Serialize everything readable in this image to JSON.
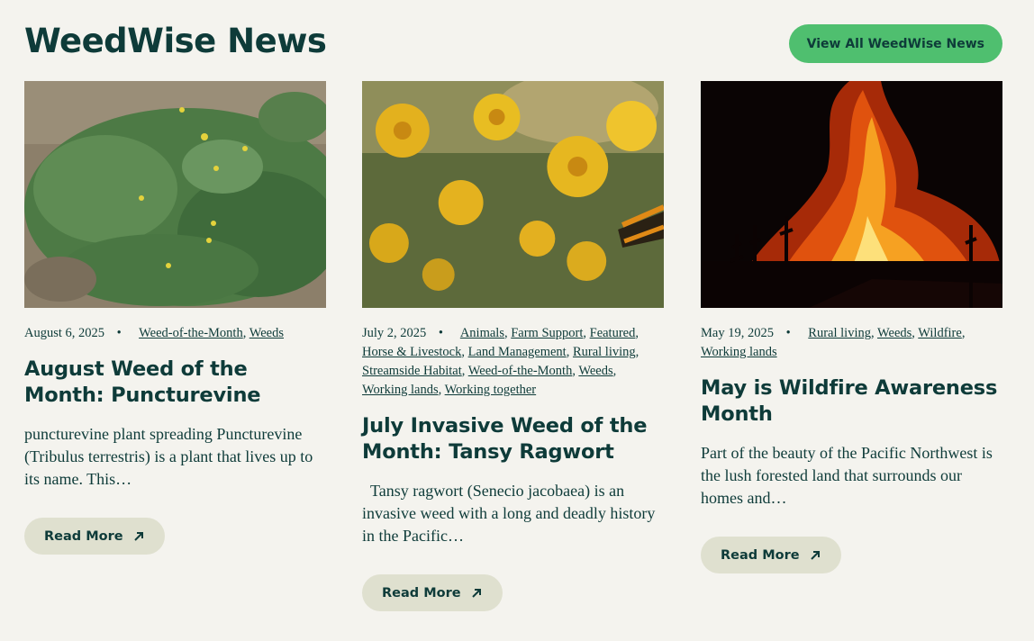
{
  "page": {
    "title": "WeedWise News",
    "view_all_label": "View All WeedWise News"
  },
  "cards": [
    {
      "date": "August 6, 2025",
      "categories": [
        "Weed-of-the-Month",
        "Weeds"
      ],
      "title": "August Weed of the Month: Puncturevine",
      "excerpt": "puncturevine plant spreading Puncturevine (Tribulus terrestris) is a plant that lives up to its name.  This…",
      "read_more": "Read More",
      "image": "puncturevine-plant-photo"
    },
    {
      "date": "July 2, 2025",
      "categories": [
        "Animals",
        "Farm Support",
        "Featured",
        "Horse & Livestock",
        "Land Management",
        "Rural living",
        "Streamside Habitat",
        "Weed-of-the-Month",
        "Weeds",
        "Working lands",
        "Working together"
      ],
      "title": "July Invasive Weed of the Month: Tansy Ragwort",
      "excerpt": "  Tansy ragwort (Senecio jacobaea) is an invasive weed with a long and deadly history in the Pacific…",
      "read_more": "Read More",
      "image": "tansy-ragwort-flowers-photo"
    },
    {
      "date": "May 19, 2025",
      "categories": [
        "Rural living",
        "Weeds",
        "Wildfire",
        "Working lands"
      ],
      "title": "May is Wildfire Awareness Month",
      "excerpt": "Part of the beauty of the Pacific Northwest is the lush forested land that surrounds our homes and…",
      "read_more": "Read More",
      "image": "wildfire-forest-photo"
    }
  ],
  "colors": {
    "text": "#0e3b39",
    "accent_green": "#4fbf6f",
    "button_beige": "#dfe0cf",
    "background": "#f4f3ee"
  }
}
